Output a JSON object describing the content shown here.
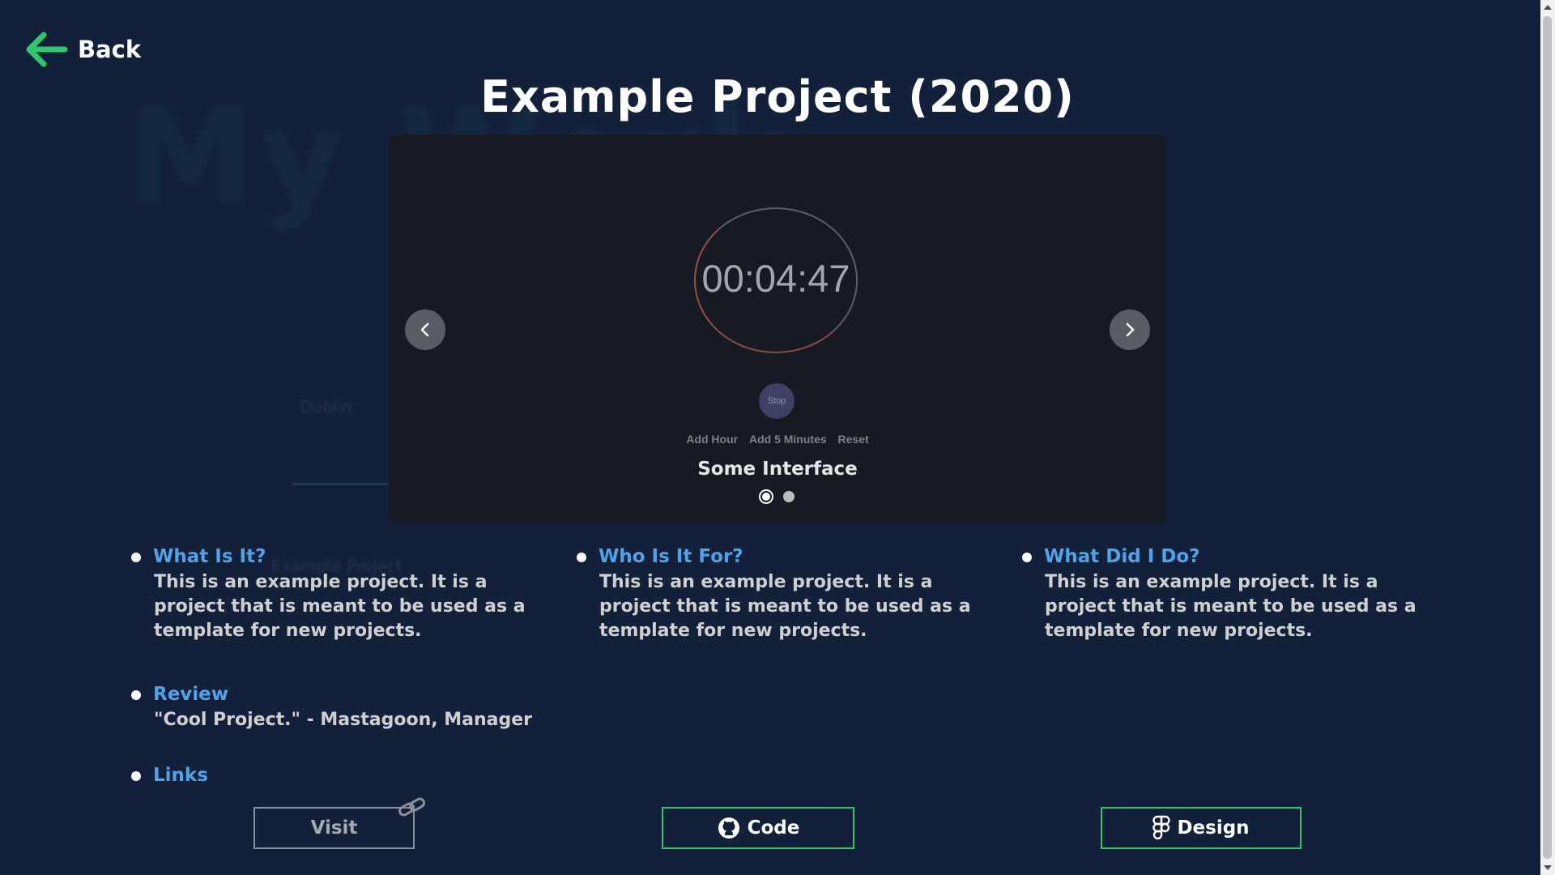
{
  "header": {
    "back_label": "Back",
    "title": "Example Project (2020)"
  },
  "background": {
    "title": "My Work",
    "ghost1": "Dublin",
    "ghost2": "Example Project"
  },
  "carousel": {
    "timer": {
      "time": "00:04:47",
      "stop_label": "Stop",
      "controls": [
        "Add Hour",
        "Add 5 Minutes",
        "Reset"
      ]
    },
    "caption": "Some Interface",
    "slides": 2,
    "active_slide": 1
  },
  "sections": {
    "what": {
      "heading": "What Is It?",
      "body": "This is an example project. It is a project that is meant to be used as a template for new projects."
    },
    "who": {
      "heading": "Who Is It For?",
      "body": "This is an example project. It is a project that is meant to be used as a template for new projects."
    },
    "did": {
      "heading": "What Did I Do?",
      "body": "This is an example project. It is a project that is meant to be used as a template for new projects."
    },
    "review": {
      "heading": "Review",
      "body": "\"Cool Project.\" - Mastagoon, Manager"
    },
    "links": {
      "heading": "Links"
    }
  },
  "buttons": {
    "visit": "Visit",
    "code": "Code",
    "design": "Design"
  },
  "colors": {
    "background": "#132039",
    "accent_green": "#2fc66b",
    "heading_blue": "#4fa3e8"
  }
}
